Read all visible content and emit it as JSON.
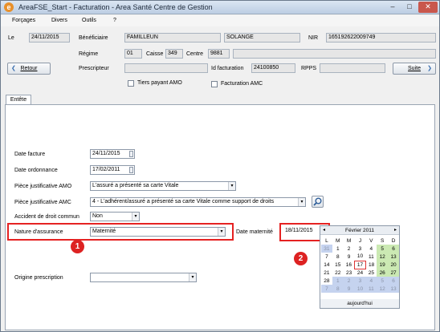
{
  "window": {
    "title": "AreaFSE_Start - Facturation - Area Santé Centre de Gestion",
    "min": "–",
    "max": "□",
    "close": "✕"
  },
  "menu": [
    "Forçages",
    "Divers",
    "Outils",
    "?"
  ],
  "header": {
    "le_label": "Le",
    "le_value": "24/11/2015",
    "beneficiaire_label": "Bénéficiaire",
    "nom": "FAMILLEUN",
    "prenom": "SOLANGE",
    "nir_label": "NIR",
    "nir_value": "165192622009749",
    "regime_label": "Régime",
    "regime_value": "01",
    "caisse_label": "Caisse",
    "caisse_value": "349",
    "centre_label": "Centre",
    "centre_value": "9881",
    "prescripteur_label": "Prescripteur",
    "idfact_label": "Id facturation",
    "idfact_value": "24100850",
    "rpps_label": "RPPS",
    "retour": "Retour",
    "suite": "Suite",
    "tiers_payant": "Tiers payant AMO",
    "facturation_amc": "Facturation AMC"
  },
  "tab": "Entête",
  "form": {
    "date_facture_label": "Date facture",
    "date_facture": "24/11/2015",
    "date_ordonnance_label": "Date ordonnance",
    "date_ordonnance": "17/02/2011",
    "pj_amo_label": "Pièce justificative AMO",
    "pj_amo": "L'assuré a présenté sa carte Vitale",
    "pj_amc_label": "Pièce justificative AMC",
    "pj_amc": "4 - L'adhérent/assuré a présenté sa carte Vitale comme support de droits",
    "accident_label": "Accident de droit commun",
    "accident": "Non",
    "nature_label": "Nature d'assurance",
    "nature": "Maternité",
    "date_maternite_label": "Date maternité",
    "date_maternite": "18/11/2015",
    "origine_label": "Origine prescription",
    "origine": ""
  },
  "badges": [
    "1",
    "2"
  ],
  "calendar": {
    "month": "Février 2011",
    "prev": "◂",
    "next": "▸",
    "days": [
      "L",
      "M",
      "M",
      "J",
      "V",
      "S",
      "D"
    ],
    "weeks": [
      [
        "31",
        "1",
        "2",
        "3",
        "4",
        "5",
        "6"
      ],
      [
        "7",
        "8",
        "9",
        "10",
        "11",
        "12",
        "13"
      ],
      [
        "14",
        "15",
        "16",
        "17",
        "18",
        "19",
        "20"
      ],
      [
        "21",
        "22",
        "23",
        "24",
        "25",
        "26",
        "27"
      ],
      [
        "28",
        "1",
        "2",
        "3",
        "4",
        "5",
        "6"
      ],
      [
        "7",
        "8",
        "9",
        "10",
        "11",
        "12",
        "13"
      ]
    ],
    "today_label": "aujourd'hui"
  }
}
